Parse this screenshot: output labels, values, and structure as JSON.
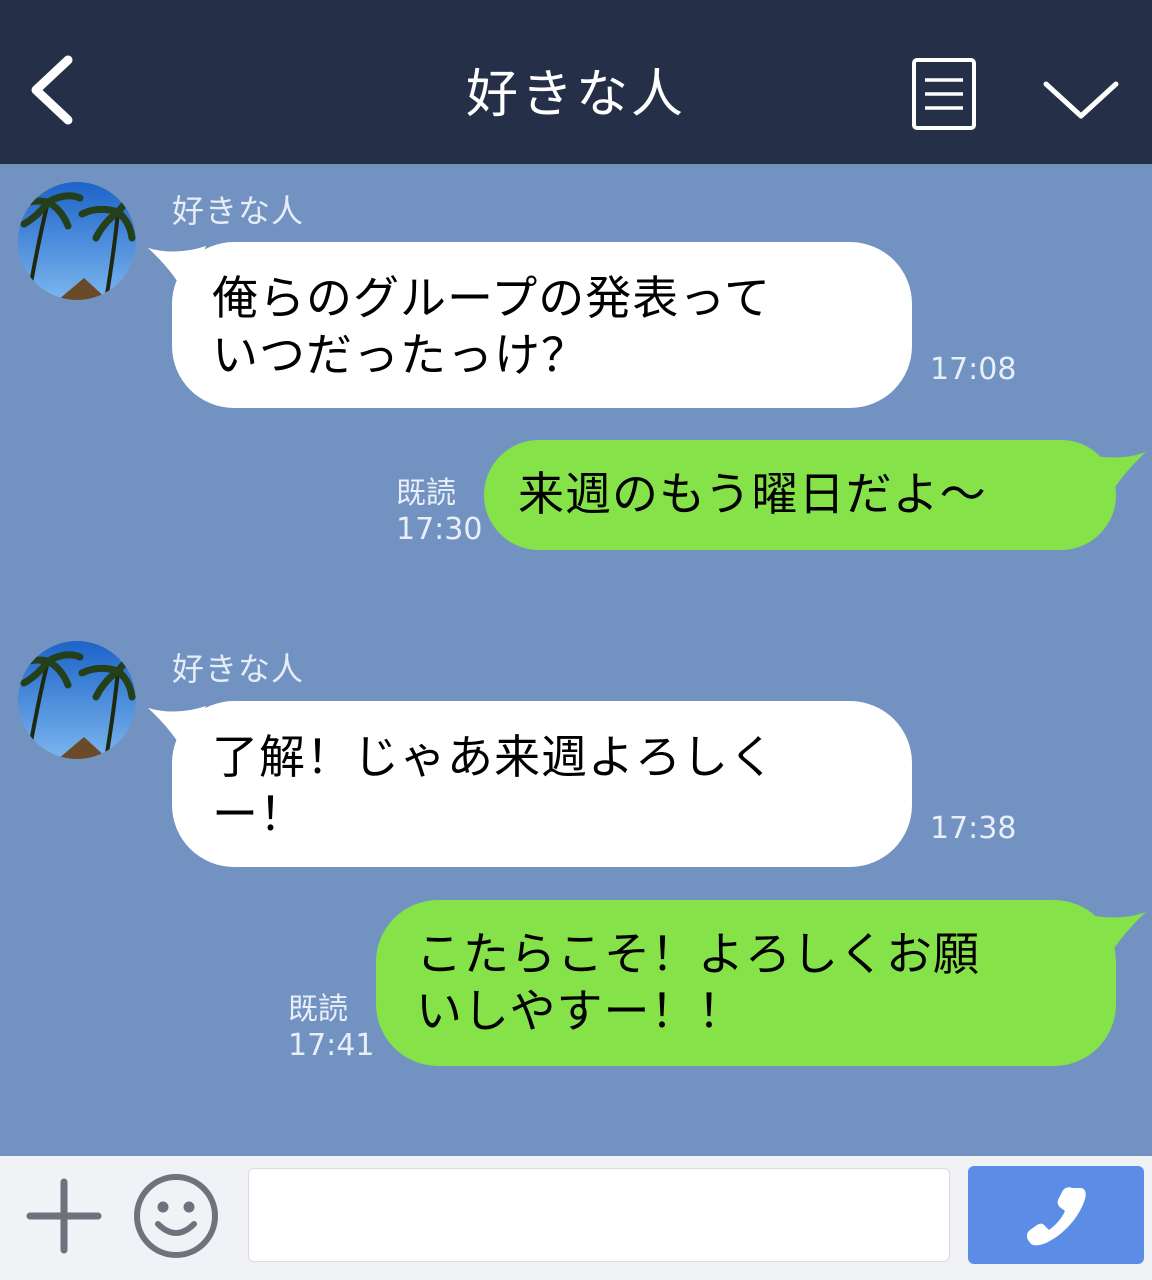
{
  "header": {
    "title": "好きな人",
    "icons": [
      "back-chevron-icon",
      "menu-list-icon",
      "chevron-down-icon"
    ]
  },
  "messages": [
    {
      "side": "left",
      "sender": "好きな人",
      "lines": [
        "俺らのグループの発表って",
        "いつだったっけ？"
      ],
      "time": "17:08"
    },
    {
      "side": "right",
      "read": "既読",
      "lines": [
        "来週のもう曜日だよ〜"
      ],
      "time": "17:30"
    },
    {
      "side": "left",
      "sender": "好きな人",
      "lines": [
        "了解！じゃあ来週よろしく",
        "ー！"
      ],
      "time": "17:38"
    },
    {
      "side": "right",
      "read": "既読",
      "lines": [
        "こたらこそ！よろしくお願",
        "いしやすー！！"
      ],
      "time": "17:41"
    }
  ],
  "footer": {
    "input_value": "",
    "icons": [
      "plus-icon",
      "smiley-icon",
      "phone-icon"
    ]
  },
  "colors": {
    "header_bg": "#252f48",
    "chat_bg": "#7293c1",
    "outgoing_bubble": "#85e249",
    "incoming_bubble": "#ffffff",
    "call_button": "#5b8ce6"
  }
}
